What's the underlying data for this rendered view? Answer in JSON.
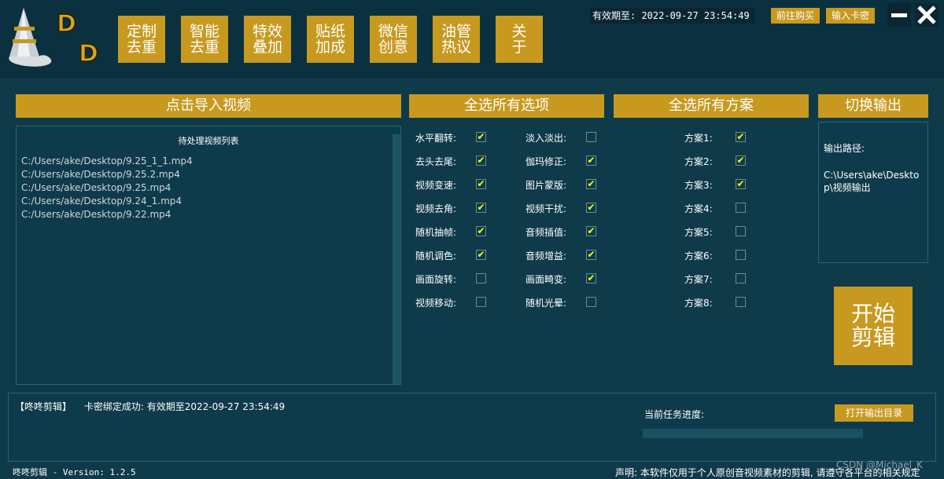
{
  "nav": [
    {
      "line1": "定制",
      "line2": "去重"
    },
    {
      "line1": "智能",
      "line2": "去重"
    },
    {
      "line1": "特效",
      "line2": "叠加"
    },
    {
      "line1": "贴纸",
      "line2": "加成"
    },
    {
      "line1": "微信",
      "line2": "创意"
    },
    {
      "line1": "油管",
      "line2": "热议"
    },
    {
      "line1": "关",
      "line2": "于"
    }
  ],
  "logo": {
    "letter": "D"
  },
  "top": {
    "expiry": "有效期至: 2022-09-27 23:54:49",
    "buy_label": "前往购买",
    "card_label": "输入卡密"
  },
  "sections": {
    "import": "点击导入视频",
    "select_all_options": "全选所有选项",
    "select_all_schemes": "全选所有方案",
    "switch_output": "切换输出"
  },
  "file_list": {
    "title": "待处理视频列表",
    "files": [
      "C:/Users/ake/Desktop/9.25_1_1.mp4",
      "C:/Users/ake/Desktop/9.25.2.mp4",
      "C:/Users/ake/Desktop/9.25.mp4",
      "C:/Users/ake/Desktop/9.24_1.mp4",
      "C:/Users/ake/Desktop/9.22.mp4"
    ]
  },
  "options_left": [
    {
      "label": "水平翻转:",
      "checked": true
    },
    {
      "label": "去头去尾:",
      "checked": true
    },
    {
      "label": "视频变速:",
      "checked": true
    },
    {
      "label": "视频去角:",
      "checked": true
    },
    {
      "label": "随机抽帧:",
      "checked": true
    },
    {
      "label": "随机调色:",
      "checked": true
    },
    {
      "label": "画面旋转:",
      "checked": false
    },
    {
      "label": "视频移动:",
      "checked": false
    }
  ],
  "options_right": [
    {
      "label": "淡入淡出:",
      "checked": false
    },
    {
      "label": "伽玛修正:",
      "checked": true
    },
    {
      "label": "图片蒙版:",
      "checked": true
    },
    {
      "label": "视频干扰:",
      "checked": true
    },
    {
      "label": "音频插值:",
      "checked": true
    },
    {
      "label": "音频增益:",
      "checked": true
    },
    {
      "label": "画面畸变:",
      "checked": true
    },
    {
      "label": "随机光晕:",
      "checked": false
    }
  ],
  "schemes": [
    {
      "label": "方案1:",
      "checked": true
    },
    {
      "label": "方案2:",
      "checked": true
    },
    {
      "label": "方案3:",
      "checked": true
    },
    {
      "label": "方案4:",
      "checked": false
    },
    {
      "label": "方案5:",
      "checked": false
    },
    {
      "label": "方案6:",
      "checked": false
    },
    {
      "label": "方案7:",
      "checked": false
    },
    {
      "label": "方案8:",
      "checked": false
    }
  ],
  "output": {
    "path_label": "输出路径:",
    "path_line1": "C:\\Users\\ake\\Deskto",
    "path_line2": "p\\视频输出"
  },
  "start": {
    "line1": "开始",
    "line2": "剪辑"
  },
  "log": {
    "tag": "【咚咚剪辑】",
    "message": "卡密绑定成功: 有效期至2022-09-27 23:54:49",
    "progress_label": "当前任务进度:",
    "progress": 0,
    "open_dir_label": "打开输出目录"
  },
  "footer": {
    "version": "咚咚剪辑 - Version: 1.2.5",
    "disclaimer": "声明: 本软件仅用于个人原创音视频素材的剪辑, 请遵守各平台的相关规定",
    "watermark": "CSDN @Michael_K"
  },
  "colors": {
    "accent": "#c7991f",
    "background": "#0f3a4a",
    "check": "#ffff00"
  }
}
